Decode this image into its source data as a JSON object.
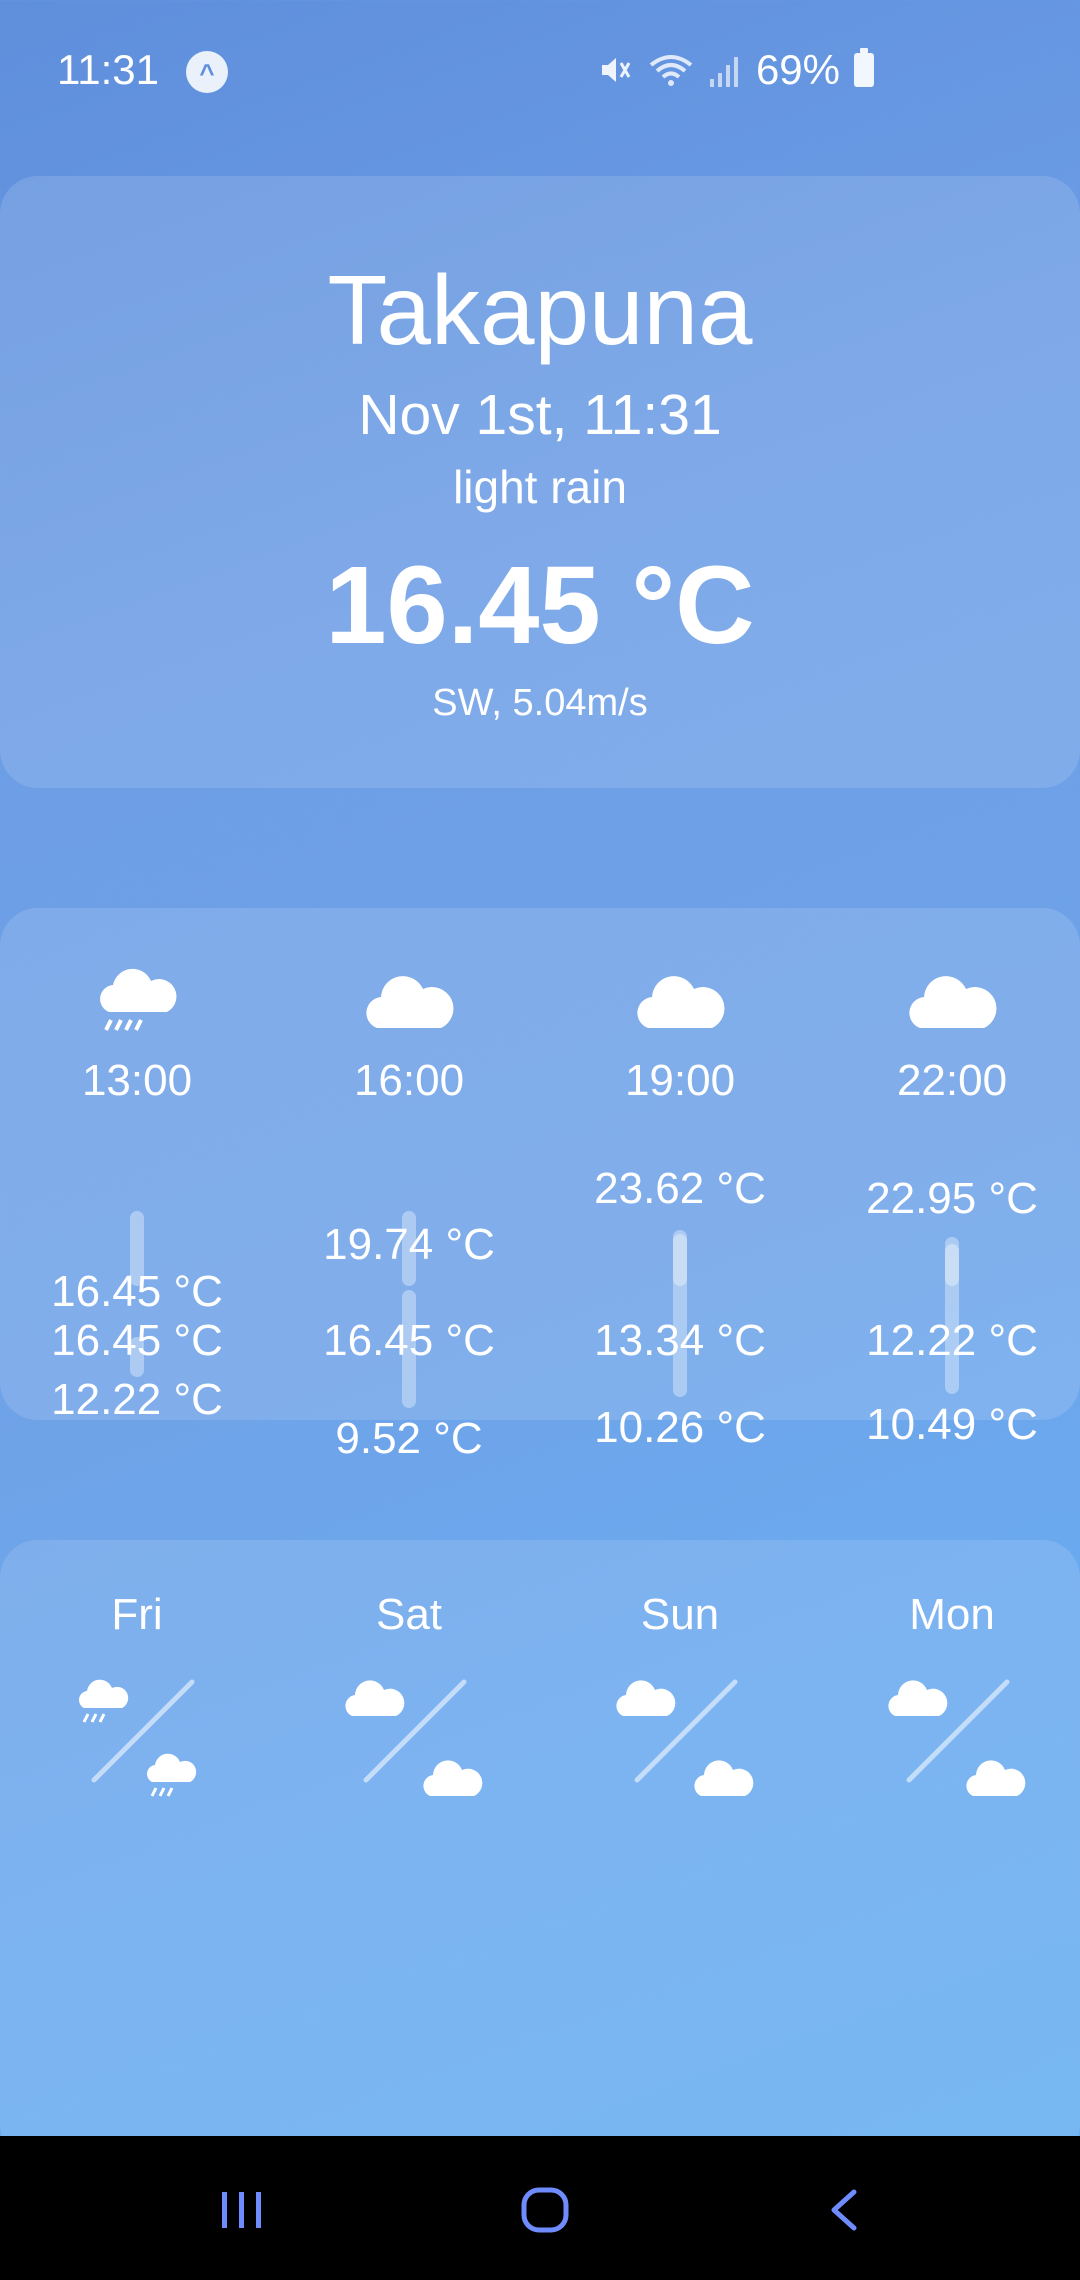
{
  "status_bar": {
    "time": "11:31",
    "notification_icon": "app-notification-icon",
    "icons": [
      "mute-icon",
      "wifi-icon",
      "signal-icon"
    ],
    "battery": "69%"
  },
  "current": {
    "city": "Takapuna",
    "datetime": "Nov 1st, 11:31",
    "description": "light rain",
    "temperature": "16.45 °C",
    "wind": "SW, 5.04m/s"
  },
  "hourly": [
    {
      "time": "13:00",
      "icon": "rain-cloud-icon",
      "temp": "16.45 °C",
      "value": 16.45
    },
    {
      "time": "16:00",
      "icon": "cloud-icon",
      "temp": "16.45 °C",
      "value": 16.45
    },
    {
      "time": "19:00",
      "icon": "cloud-icon",
      "temp": "13.34 °C",
      "value": 13.34
    },
    {
      "time": "22:00",
      "icon": "cloud-icon",
      "temp": "12.22 °C",
      "value": 12.22
    }
  ],
  "daily": [
    {
      "day": "Fri",
      "icon_day": "rain-cloud-icon",
      "icon_night": "rain-cloud-icon",
      "high": "16.45 °C",
      "low": "12.22 °C",
      "high_value": 16.45,
      "low_value": 12.22
    },
    {
      "day": "Sat",
      "icon_day": "cloud-icon",
      "icon_night": "cloud-icon",
      "high": "19.74 °C",
      "low": "9.52 °C",
      "high_value": 19.74,
      "low_value": 9.52
    },
    {
      "day": "Sun",
      "icon_day": "cloud-icon",
      "icon_night": "cloud-icon",
      "high": "23.62 °C",
      "low": "10.26 °C",
      "high_value": 23.62,
      "low_value": 10.26
    },
    {
      "day": "Mon",
      "icon_day": "cloud-icon",
      "icon_night": "cloud-icon",
      "high": "22.95 °C",
      "low": "10.49 °C",
      "high_value": 22.95,
      "low_value": 10.49
    }
  ],
  "navbar": {
    "recents": "recents-icon",
    "home": "home-icon",
    "back": "back-icon"
  }
}
